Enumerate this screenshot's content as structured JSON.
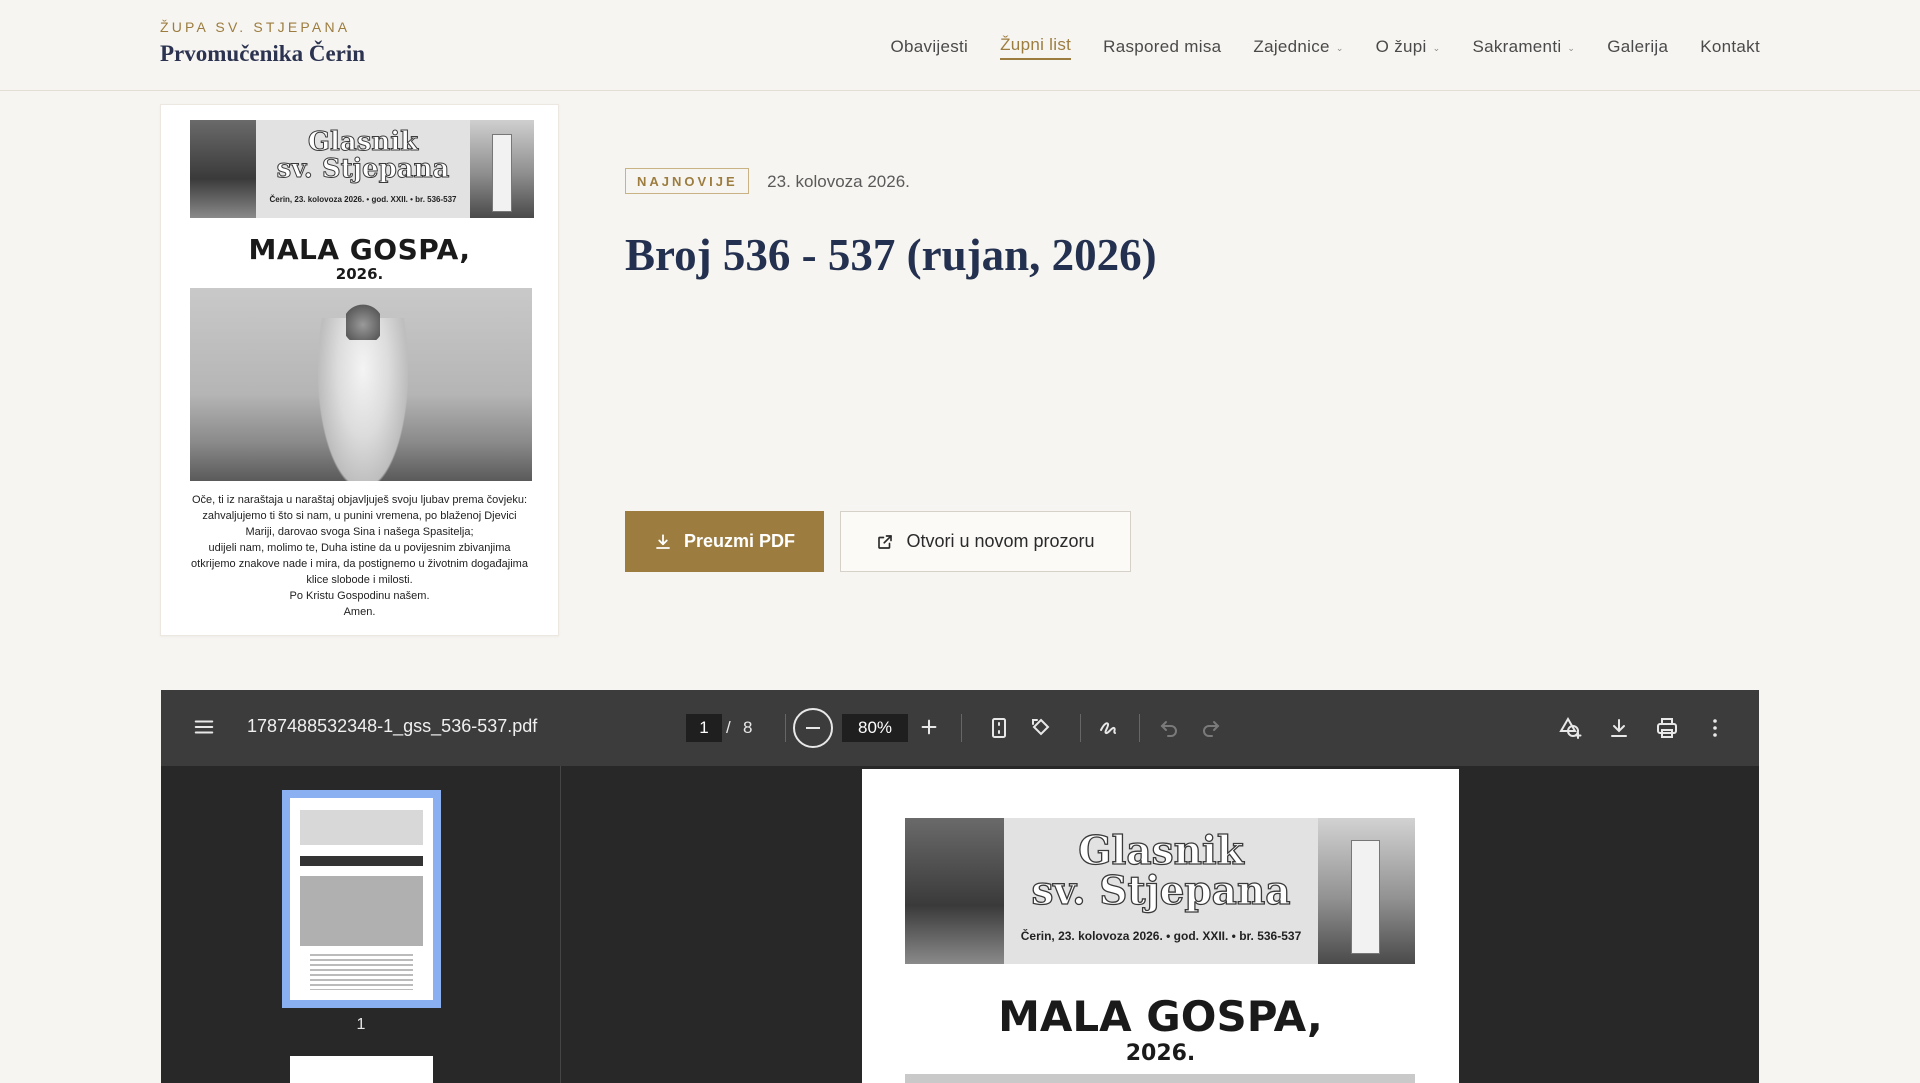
{
  "header": {
    "kicker": "ŽUPA SV. STJEPANA",
    "name": "Prvomučenika Čerin",
    "nav": [
      {
        "label": "Obavijesti"
      },
      {
        "label": "Župni list"
      },
      {
        "label": "Raspored misa"
      },
      {
        "label": "Zajednice"
      },
      {
        "label": "O župi"
      },
      {
        "label": "Sakramenti"
      },
      {
        "label": "Galerija"
      },
      {
        "label": "Kontakt"
      }
    ]
  },
  "cover": {
    "title_line1": "Glasnik",
    "title_line2": "sv. Stjepana",
    "subtitle": "Čerin, 23. kolovoza 2026. • god. XXII. • br. 536-537",
    "headline": "MALA GOSPA,",
    "year": "2026.",
    "prayer": [
      "Oče, ti iz naraštaja u naraštaj objavljuješ svoju ljubav prema čovjeku:",
      "zahvaljujemo ti što si nam, u punini vremena, po blaženoj Djevici",
      "Mariji, darovao svoga Sina i našega Spasitelja;",
      "udijeli nam, molimo te, Duha istine da u povijesnim zbivanjima",
      "otkrijemo znakove nade i mira, da postignemo u životnim događajima",
      "klice slobode i milosti.",
      "Po Kristu Gospodinu našem.",
      "Amen."
    ]
  },
  "issue": {
    "badge": "NAJNOVIJE",
    "date": "23. kolovoza 2026.",
    "title": "Broj 536 - 537 (rujan, 2026)",
    "download_label": "Preuzmi PDF",
    "open_label": "Otvori u novom prozoru"
  },
  "viewer": {
    "filename": "1787488532348-1_gss_536-537.pdf",
    "current_page": "1",
    "page_sep": "/",
    "total_pages": "8",
    "zoom": "80%",
    "thumb_label": "1"
  },
  "colors": {
    "accent": "#9c7d3f",
    "title": "#23304f",
    "viewer_toolbar": "#3c3c3c",
    "viewer_bg": "#282828",
    "thumb_selected": "#8ab0f2"
  }
}
